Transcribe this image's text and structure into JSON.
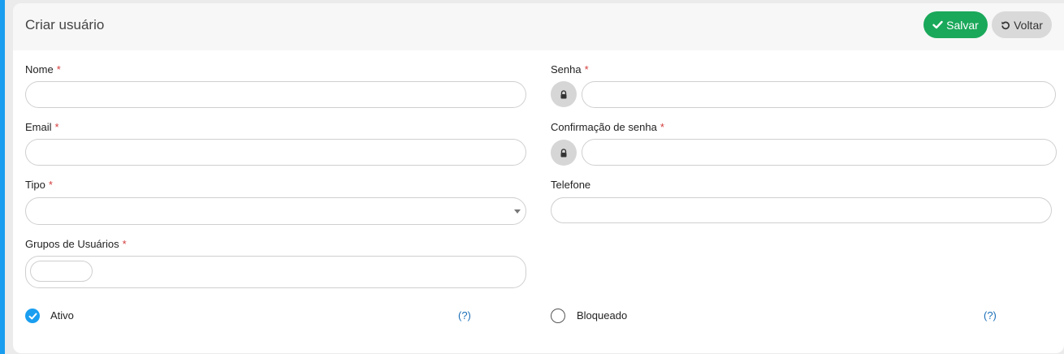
{
  "header": {
    "title": "Criar usuário",
    "save_label": "Salvar",
    "back_label": "Voltar"
  },
  "form": {
    "required_mark": "*",
    "nome": {
      "label": "Nome",
      "value": "",
      "placeholder": ""
    },
    "senha": {
      "label": "Senha",
      "value": "",
      "placeholder": ""
    },
    "email": {
      "label": "Email",
      "value": "",
      "placeholder": ""
    },
    "confirmacao": {
      "label": "Confirmação de senha",
      "value": "",
      "placeholder": ""
    },
    "tipo": {
      "label": "Tipo",
      "selected": ""
    },
    "telefone": {
      "label": "Telefone",
      "value": "",
      "placeholder": ""
    },
    "grupos": {
      "label": "Grupos de Usuários",
      "value": ""
    },
    "ativo": {
      "label": "Ativo",
      "checked": true,
      "help": "(?)"
    },
    "bloqueado": {
      "label": "Bloqueado",
      "checked": false,
      "help": "(?)"
    }
  },
  "colors": {
    "accent": "#1a9ef0",
    "save": "#1aa85a",
    "required": "#d43c3c",
    "help_link": "#1a6fb8"
  },
  "icons": [
    "check-icon",
    "undo-icon",
    "lock-icon",
    "caret-down-icon"
  ]
}
